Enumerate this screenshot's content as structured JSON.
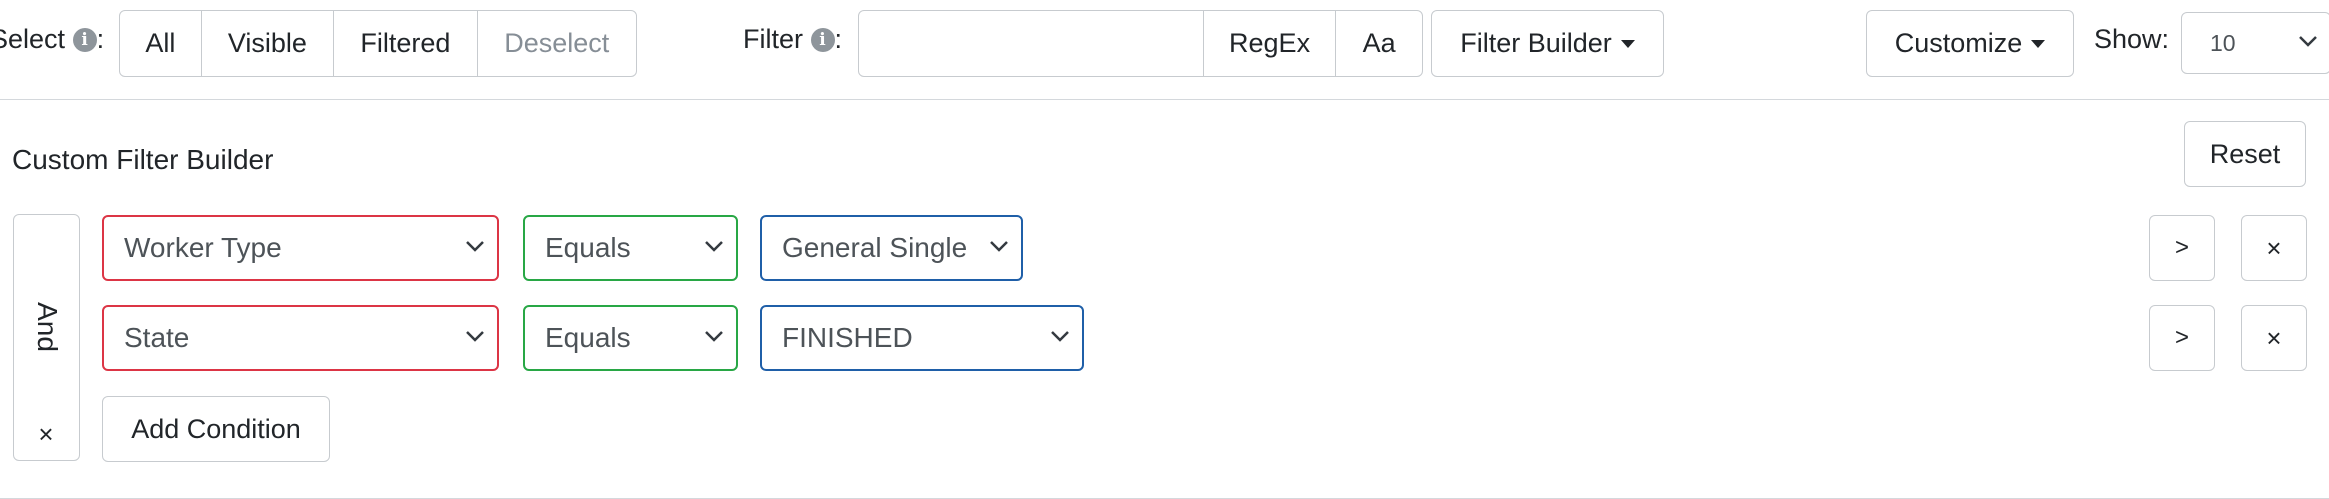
{
  "toolbar": {
    "select_label": "Select",
    "select_buttons": [
      "All",
      "Visible",
      "Filtered",
      "Deselect"
    ],
    "filter_label": "Filter",
    "filter_value": "",
    "regex_label": "RegEx",
    "case_label": "Aa",
    "filter_builder_label": "Filter Builder",
    "customize_label": "Customize",
    "show_label": "Show:",
    "show_value": "10"
  },
  "builder": {
    "title": "Custom Filter Builder",
    "reset_label": "Reset",
    "logic_label": "And",
    "logic_remove": "×",
    "add_condition_label": "Add Condition",
    "conditions": [
      {
        "field": "Worker Type",
        "operator": "Equals",
        "value": "General Single",
        "indent": ">",
        "remove": "×"
      },
      {
        "field": "State",
        "operator": "Equals",
        "value": "FINISHED",
        "indent": ">",
        "remove": "×"
      }
    ]
  },
  "colors": {
    "field_border": "#dc3545",
    "operator_border": "#28a745",
    "value_border": "#1f5fa8",
    "disabled_text": "#868e96"
  }
}
